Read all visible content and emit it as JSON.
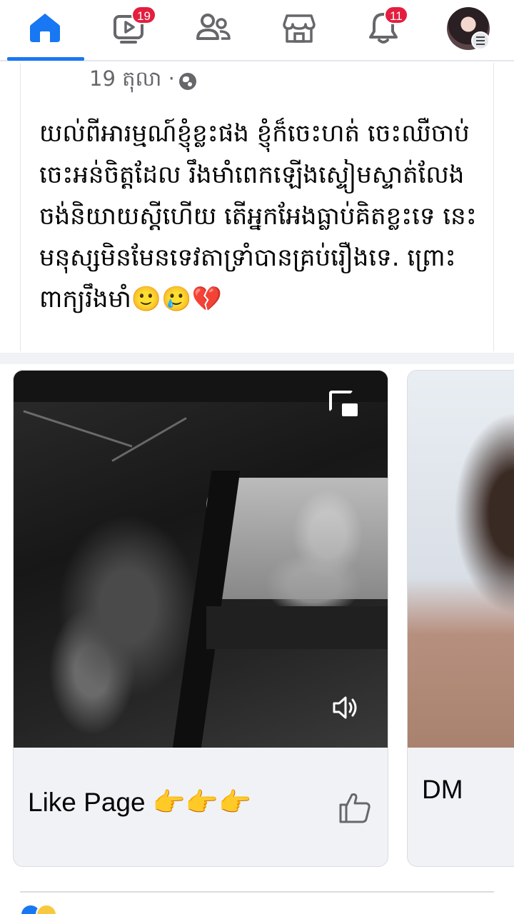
{
  "topnav": {
    "items": [
      {
        "name": "Home",
        "icon": "home-icon",
        "active": true
      },
      {
        "name": "Watch",
        "icon": "video-icon",
        "badge": "19"
      },
      {
        "name": "Friends",
        "icon": "friends-icon"
      },
      {
        "name": "Marketplace",
        "icon": "marketplace-icon"
      },
      {
        "name": "Notifications",
        "icon": "bell-icon",
        "badge": "11"
      },
      {
        "name": "Profile",
        "icon": "avatar"
      }
    ],
    "accent_color": "#1877f2",
    "badge_color": "#e41e3f"
  },
  "post": {
    "date": "19 តុលា ·",
    "privacy_icon": "globe-icon",
    "text": "យល់ពីអារម្មណ៍ខ្ញុំខ្លះផង ខ្ញុំក៏ចេះហត់ ចេះឈឺចាប់ ចេះអន់ចិត្តដែល រឹងមាំពេកឡើងស្ទៀមស្ទាត់លែងចង់និយាយស្តីហើយ តើអ្នកអែងធ្លាប់គិតខ្លះទេ នេះមនុស្សមិនមែនទេវតាទ្រាំបានគ្រប់រឿងទេ. ព្រោះពាក្យរឹងមាំ🙂🥲💔"
  },
  "reels": [
    {
      "caption": "Like Page 👉👉👉",
      "icons": [
        "pip-icon",
        "sound-icon",
        "thumbs-up-icon"
      ]
    },
    {
      "caption": "DM"
    }
  ]
}
